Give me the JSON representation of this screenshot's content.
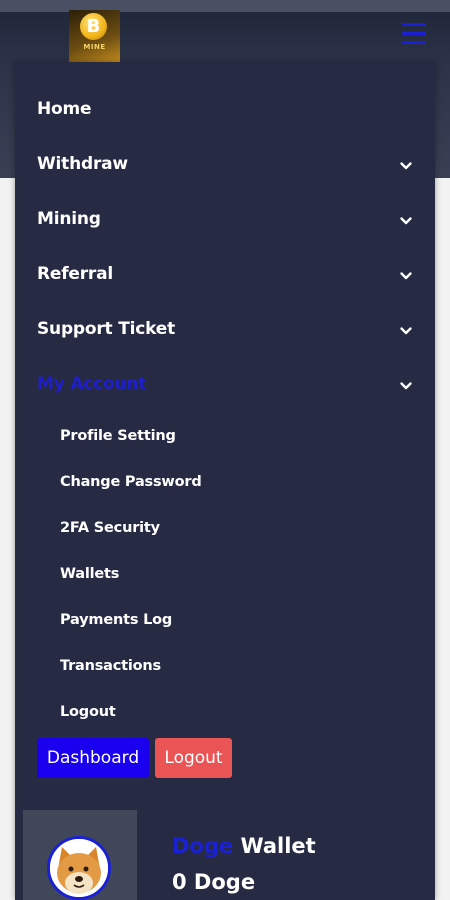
{
  "header": {
    "logo_text": "MINE",
    "logo_glyph": "B",
    "menu_icon": "hamburger-icon"
  },
  "nav": {
    "items": [
      {
        "label": "Home",
        "has_dropdown": false
      },
      {
        "label": "Withdraw",
        "has_dropdown": true
      },
      {
        "label": "Mining",
        "has_dropdown": true
      },
      {
        "label": "Referral",
        "has_dropdown": true
      },
      {
        "label": "Support Ticket",
        "has_dropdown": true
      },
      {
        "label": "My Account",
        "has_dropdown": true,
        "active": true
      }
    ],
    "account_submenu": [
      "Profile Setting",
      "Change Password",
      "2FA Security",
      "Wallets",
      "Payments Log",
      "Transactions",
      "Logout"
    ]
  },
  "buttons": {
    "dashboard_label": "Dashboard",
    "logout_label": "Logout"
  },
  "wallet": {
    "currency": "Doge",
    "title_suffix": "Wallet",
    "balance": "0 Doge"
  },
  "colors": {
    "menu_bg": "#262b43",
    "accent_blue": "#1a00ee",
    "active_text": "#1f1fc8",
    "logout_red": "#ea5455"
  }
}
